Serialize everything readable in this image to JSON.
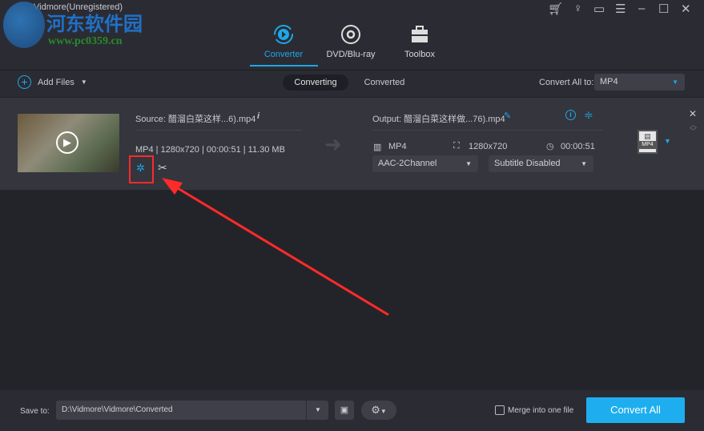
{
  "app_title": "Vidmore(Unregistered)",
  "watermark": {
    "name": "河东软件园",
    "url": "www.pc0359.cn"
  },
  "nav_tabs": [
    {
      "label": "Converter",
      "active": true
    },
    {
      "label": "DVD/Blu-ray"
    },
    {
      "label": "Toolbox"
    }
  ],
  "toolbar": {
    "add_files": "Add Files",
    "seg": [
      "Converting",
      "Converted"
    ],
    "convert_all_to_label": "Convert All to:",
    "convert_all_to_value": "MP4"
  },
  "item": {
    "source": "Source: 醋溜白菜这样...6).mp4",
    "source_meta": "MP4 | 1280x720 | 00:00:51 | 11.30 MB",
    "output": "Output: 醋溜白菜这样做...76).mp4",
    "out_format": "MP4",
    "out_resolution": "1280x720",
    "out_duration": "00:00:51",
    "audio": "AAC-2Channel",
    "subtitle": "Subtitle Disabled",
    "format_badge": "MP4"
  },
  "bottom": {
    "save_to_label": "Save to:",
    "save_path": "D:\\Vidmore\\Vidmore\\Converted",
    "merge_label": "Merge into one file",
    "convert_all": "Convert All"
  },
  "colors": {
    "accent": "#1ea7e8",
    "convert_btn": "#1eaef0",
    "annotation": "#ff2a2a"
  }
}
